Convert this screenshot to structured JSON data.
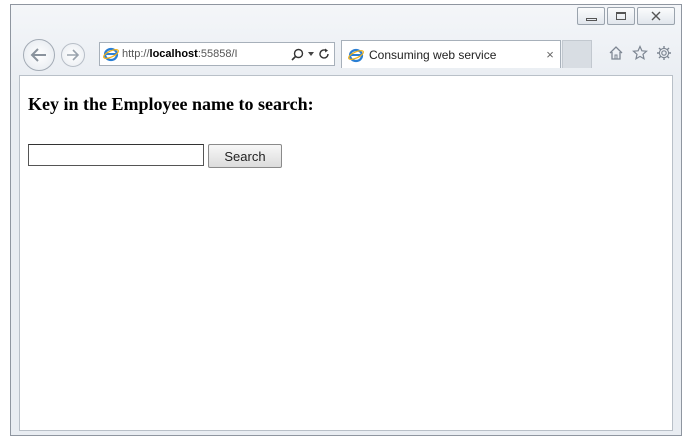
{
  "browser": {
    "address": {
      "prefix": "http://",
      "host": "localhost",
      "rest": ":55858/I"
    },
    "tab": {
      "title": "Consuming web service",
      "close_glyph": "×"
    },
    "icons": {
      "back": "back-arrow-icon",
      "forward": "forward-arrow-icon",
      "search": "search-icon",
      "refresh": "refresh-icon",
      "home": "home-icon",
      "favorites": "star-icon",
      "settings": "gear-icon"
    },
    "colors": {
      "ie_blue": "#2a7fd4",
      "ie_gold": "#f2b21a"
    }
  },
  "page": {
    "heading": "Key in the Employee name to search:",
    "search_input_value": "",
    "search_button_label": "Search"
  }
}
